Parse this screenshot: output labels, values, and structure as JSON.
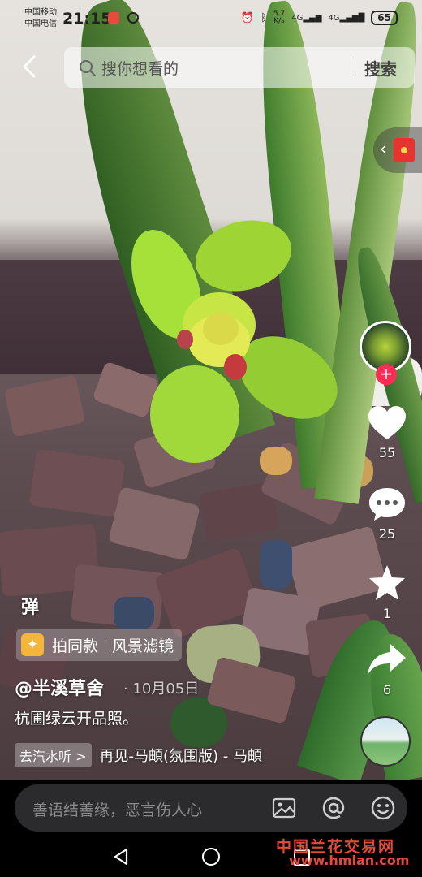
{
  "status_bar": {
    "carrier_1": "中国移动",
    "carrier_2": "中国电信",
    "time": "21:15",
    "net_speed_value": "5.7",
    "net_speed_unit": "K/s",
    "signal_1": "4G",
    "signal_2": "4G",
    "battery": "65"
  },
  "search": {
    "placeholder": "搜你想看的",
    "button_label": "搜索"
  },
  "side_actions": {
    "likes": "55",
    "comments": "25",
    "favorites": "1",
    "shares": "6"
  },
  "overlay": {
    "danmu_label": "弹",
    "effect_label": "拍同款",
    "filter_label": "风景滤镜",
    "author": "@半溪草舍",
    "date": "· 10月05日",
    "caption": "杭圃绿云开品照。",
    "music_tag": "去汽水听 >",
    "music_title": "再见-马頔(氛围版)  - 马頔"
  },
  "comment_bar": {
    "placeholder": "善语结善缘，恶言伤人心"
  },
  "watermark": {
    "line1": "中国兰花交易网",
    "line2": "www.hmlan.com"
  },
  "colors": {
    "like_red": "#ff2c55",
    "effect_gold": "#f4b53a",
    "watermark_red": "#e24a3a"
  }
}
